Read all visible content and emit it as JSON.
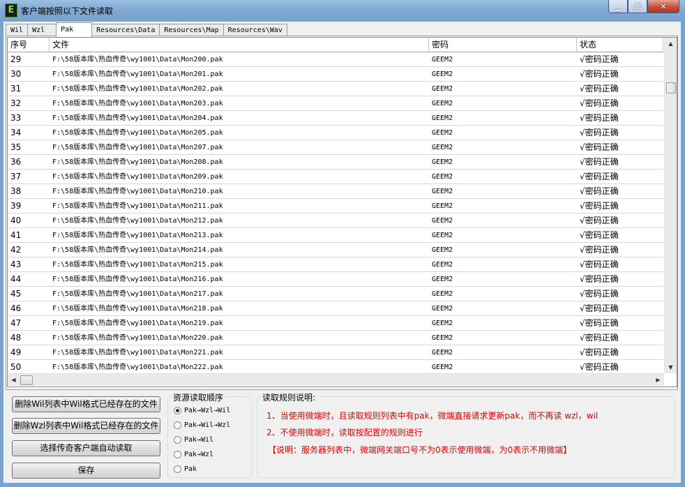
{
  "window": {
    "title": "客户端按照以下文件读取",
    "app_icon_letter": "E"
  },
  "tabs": [
    "Wil",
    "Wzl",
    "Pak",
    "Resources\\Data",
    "Resources\\Map",
    "Resources\\Wav"
  ],
  "active_tab": "Pak",
  "table": {
    "columns": [
      "序号",
      "文件",
      "密码",
      "状态"
    ],
    "rows": [
      [
        "29",
        "F:\\58版本库\\热血传奇\\wy1001\\Data\\Mon200.pak",
        "GEEM2",
        "√密码正确"
      ],
      [
        "30",
        "F:\\58版本库\\热血传奇\\wy1001\\Data\\Mon201.pak",
        "GEEM2",
        "√密码正确"
      ],
      [
        "31",
        "F:\\58版本库\\热血传奇\\wy1001\\Data\\Mon202.pak",
        "GEEM2",
        "√密码正确"
      ],
      [
        "32",
        "F:\\58版本库\\热血传奇\\wy1001\\Data\\Mon203.pak",
        "GEEM2",
        "√密码正确"
      ],
      [
        "33",
        "F:\\58版本库\\热血传奇\\wy1001\\Data\\Mon204.pak",
        "GEEM2",
        "√密码正确"
      ],
      [
        "34",
        "F:\\58版本库\\热血传奇\\wy1001\\Data\\Mon205.pak",
        "GEEM2",
        "√密码正确"
      ],
      [
        "35",
        "F:\\58版本库\\热血传奇\\wy1001\\Data\\Mon207.pak",
        "GEEM2",
        "√密码正确"
      ],
      [
        "36",
        "F:\\58版本库\\热血传奇\\wy1001\\Data\\Mon208.pak",
        "GEEM2",
        "√密码正确"
      ],
      [
        "37",
        "F:\\58版本库\\热血传奇\\wy1001\\Data\\Mon209.pak",
        "GEEM2",
        "√密码正确"
      ],
      [
        "38",
        "F:\\58版本库\\热血传奇\\wy1001\\Data\\Mon210.pak",
        "GEEM2",
        "√密码正确"
      ],
      [
        "39",
        "F:\\58版本库\\热血传奇\\wy1001\\Data\\Mon211.pak",
        "GEEM2",
        "√密码正确"
      ],
      [
        "40",
        "F:\\58版本库\\热血传奇\\wy1001\\Data\\Mon212.pak",
        "GEEM2",
        "√密码正确"
      ],
      [
        "41",
        "F:\\58版本库\\热血传奇\\wy1001\\Data\\Mon213.pak",
        "GEEM2",
        "√密码正确"
      ],
      [
        "42",
        "F:\\58版本库\\热血传奇\\wy1001\\Data\\Mon214.pak",
        "GEEM2",
        "√密码正确"
      ],
      [
        "43",
        "F:\\58版本库\\热血传奇\\wy1001\\Data\\Mon215.pak",
        "GEEM2",
        "√密码正确"
      ],
      [
        "44",
        "F:\\58版本库\\热血传奇\\wy1001\\Data\\Mon216.pak",
        "GEEM2",
        "√密码正确"
      ],
      [
        "45",
        "F:\\58版本库\\热血传奇\\wy1001\\Data\\Mon217.pak",
        "GEEM2",
        "√密码正确"
      ],
      [
        "46",
        "F:\\58版本库\\热血传奇\\wy1001\\Data\\Mon218.pak",
        "GEEM2",
        "√密码正确"
      ],
      [
        "47",
        "F:\\58版本库\\热血传奇\\wy1001\\Data\\Mon219.pak",
        "GEEM2",
        "√密码正确"
      ],
      [
        "48",
        "F:\\58版本库\\热血传奇\\wy1001\\Data\\Mon220.pak",
        "GEEM2",
        "√密码正确"
      ],
      [
        "49",
        "F:\\58版本库\\热血传奇\\wy1001\\Data\\Mon221.pak",
        "GEEM2",
        "√密码正确"
      ],
      [
        "50",
        "F:\\58版本库\\热血传奇\\wy1001\\Data\\Mon222.pak",
        "GEEM2",
        "√密码正确"
      ]
    ]
  },
  "buttons": {
    "delete_wil": "删除Wil列表中Wil格式已经存在的文件",
    "delete_wzl": "删除Wzl列表中Wil格式已经存在的文件",
    "auto_read": "选择传奇客户端自动读取",
    "save": "保存"
  },
  "read_order": {
    "title": "资源读取顺序",
    "options": [
      "Pak→Wzl→Wil",
      "Pak→Wil→Wzl",
      "Pak→Wil",
      "Pak→Wzl",
      "Pak"
    ],
    "selected": "Pak→Wzl→Wil"
  },
  "rules": {
    "title": "读取规则说明:",
    "lines": [
      "1、当使用微端时，且读取规则列表中有pak，微端直接请求更新pak，而不再读 wzl，wil",
      "2、不使用微端时，读取按配置的规则进行",
      "【说明：服务器列表中，微端网关端口号不为0表示使用微端，为0表示不用微端】"
    ],
    "text_color": "#e00000"
  }
}
